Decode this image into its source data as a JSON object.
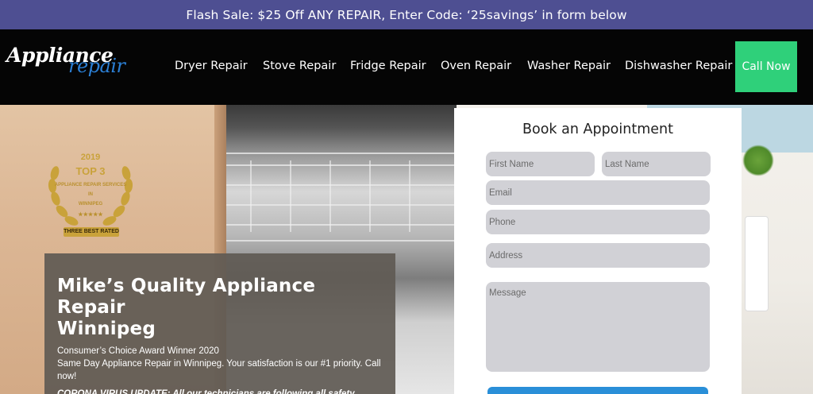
{
  "flash_bar": {
    "text": "Flash Sale: $25 Off ANY REPAIR, Enter Code: ‘25savings’ in form below"
  },
  "header": {
    "logo": {
      "word1": "Appliance",
      "word2": "repair"
    },
    "nav": [
      {
        "label": "Dryer Repair"
      },
      {
        "label": "Stove Repair"
      },
      {
        "label": "Fridge Repair"
      },
      {
        "label": "Oven Repair"
      },
      {
        "label": "Washer Repair"
      },
      {
        "label": "Dishwasher Repair"
      }
    ],
    "call_button": "Call Now"
  },
  "badge": {
    "year": "2019",
    "rank": "TOP 3",
    "line1": "APPLIANCE REPAIR SERVICES",
    "line2": "IN",
    "line3": "WINNIPEG",
    "stars": "★★★★★",
    "ribbon": "THREE BEST RATED"
  },
  "hero": {
    "title_line1": "Mike’s Quality Appliance Repair",
    "title_line2": "Winnipeg",
    "award": "Consumer’s Choice Award Winner 2020",
    "same_day": "Same Day Appliance Repair in Winnipeg. Your satisfaction is our #1 priority. Call now!",
    "covid": "CORONA VIRUS UPDATE: All our technicians are following all safety procedures (using masks and gloves). Your safety is our priority."
  },
  "form": {
    "title": "Book an Appointment",
    "first_name_placeholder": "First Name",
    "last_name_placeholder": "Last Name",
    "email_placeholder": "Email",
    "phone_placeholder": "Phone",
    "address_placeholder": "Address",
    "message_placeholder": "Message"
  },
  "colors": {
    "flash_bar_bg": "#4e4f92",
    "header_bg": "#050505",
    "call_button_bg": "#2fd07a",
    "logo_accent": "#2b7fd4",
    "field_bg": "#d1d1d6",
    "submit_bg": "#2a8fd8"
  }
}
